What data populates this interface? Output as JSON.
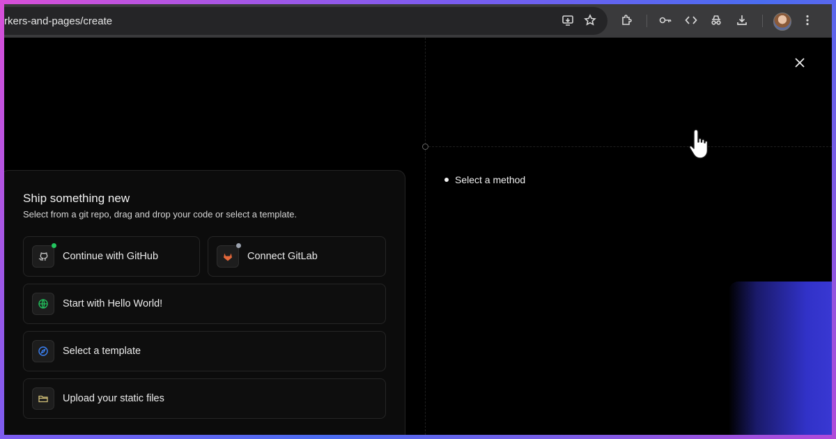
{
  "browser": {
    "url": "rkers-and-pages/create"
  },
  "colors": {
    "background_gradient": [
      "#d94fd8",
      "#7b5cf0",
      "#4a6cf0"
    ],
    "panel": "#0c0c0c",
    "github_badge": "#22c55e",
    "gitlab_badge": "#9ca3af",
    "globe_icon": "#22c55e",
    "template_icon": "#3b82f6",
    "folder_icon": "#d4c27a",
    "gitlab_icon": "#e2673a"
  },
  "main": {
    "title": "Ship something new",
    "subtitle": "Select from a git repo, drag and drop your code or select a template.",
    "options": [
      {
        "label": "Continue with GitHub",
        "icon": "github-icon"
      },
      {
        "label": "Connect GitLab",
        "icon": "gitlab-icon"
      },
      {
        "label": "Start with Hello World!",
        "icon": "globe-icon"
      },
      {
        "label": "Select a template",
        "icon": "compass-icon"
      },
      {
        "label": "Upload your static files",
        "icon": "folder-icon"
      }
    ]
  },
  "side": {
    "method_label": "Select a method"
  }
}
